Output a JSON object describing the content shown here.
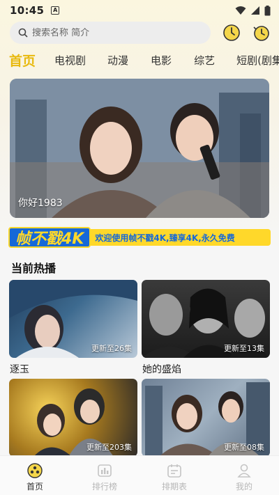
{
  "status_bar": {
    "time": "10:45",
    "notif_letter": "A"
  },
  "search": {
    "placeholder": "搜索名称 简介"
  },
  "tabs": [
    {
      "label": "首页",
      "active": true
    },
    {
      "label": "电视剧"
    },
    {
      "label": "动漫"
    },
    {
      "label": "电影"
    },
    {
      "label": "综艺"
    },
    {
      "label": "短剧(剧集"
    }
  ],
  "banner": {
    "caption": "你好1983"
  },
  "promo": {
    "logo": "帧不戳4K",
    "text": "欢迎使用帧不戳4K,臻享4K,永久免费"
  },
  "section": {
    "title": "当前热播"
  },
  "cards": [
    {
      "title": "逐玉",
      "badge": "更新至26集"
    },
    {
      "title": "她的盛焰",
      "badge": "更新至13集"
    },
    {
      "title": "",
      "badge": "更新至203集"
    },
    {
      "title": "",
      "badge": "更新至08集"
    }
  ],
  "bottom_nav": [
    {
      "label": "首页",
      "active": true,
      "icon": "home-icon"
    },
    {
      "label": "排行榜",
      "icon": "ranking-icon"
    },
    {
      "label": "排期表",
      "icon": "calendar-icon"
    },
    {
      "label": "我的",
      "icon": "profile-icon"
    }
  ],
  "colors": {
    "accent": "#e8b90e",
    "promo_blue": "#1568d8",
    "promo_yellow": "#ffd82a"
  }
}
